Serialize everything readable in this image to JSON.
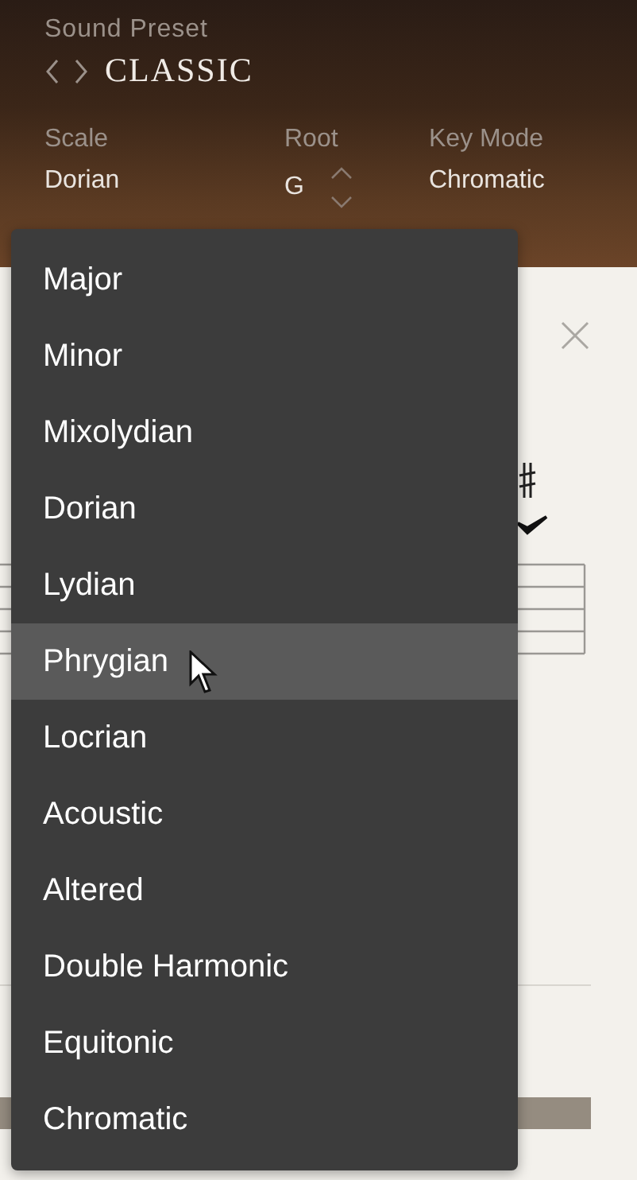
{
  "preset": {
    "label": "Sound Preset",
    "name": "CLASSIC"
  },
  "fields": [
    {
      "kind": "plain",
      "label": "Scale",
      "value": "Dorian"
    },
    {
      "kind": "stepper",
      "label": "Root",
      "value": "G"
    },
    {
      "kind": "plain",
      "label": "Key Mode",
      "value": "Chromatic"
    }
  ],
  "scale_menu": {
    "items": [
      {
        "label": "Major",
        "selected": false
      },
      {
        "label": "Minor",
        "selected": false
      },
      {
        "label": "Mixolydian",
        "selected": false
      },
      {
        "label": "Dorian",
        "selected": false
      },
      {
        "label": "Lydian",
        "selected": false
      },
      {
        "label": "Phrygian",
        "selected": true
      },
      {
        "label": "Locrian",
        "selected": false
      },
      {
        "label": "Acoustic",
        "selected": false
      },
      {
        "label": "Altered",
        "selected": false
      },
      {
        "label": "Double Harmonic",
        "selected": false
      },
      {
        "label": "Equitonic",
        "selected": false
      },
      {
        "label": "Chromatic",
        "selected": false
      }
    ]
  }
}
